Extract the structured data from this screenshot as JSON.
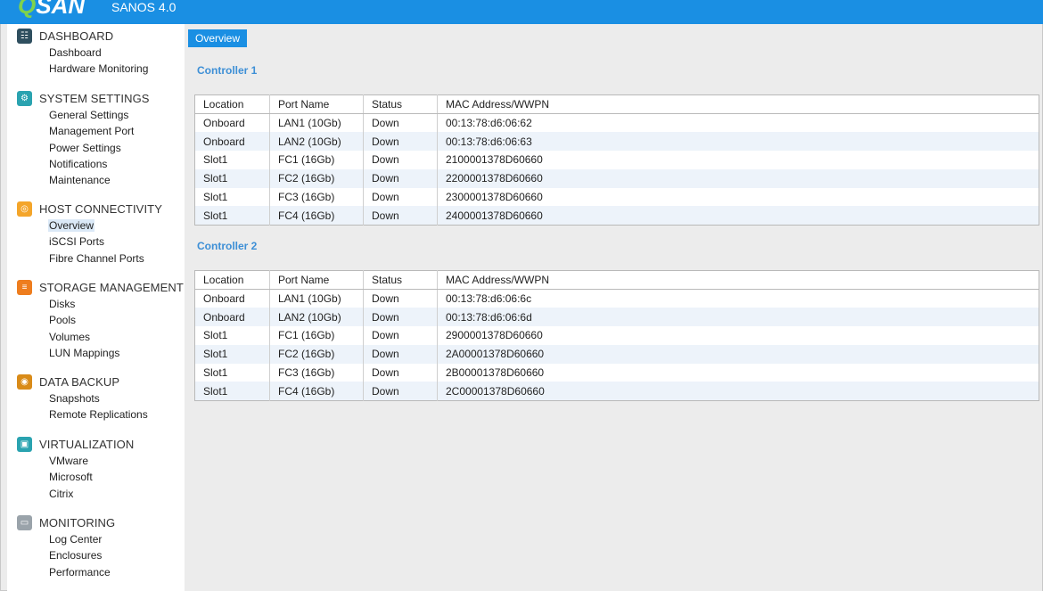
{
  "app": {
    "logo": "QSAN",
    "version": "SANOS 4.0"
  },
  "colors": {
    "brand": "#1a8fe3",
    "logo_accent": "#7fd34b",
    "section_title": "#3d8fd6"
  },
  "sidebar": [
    {
      "title": "DASHBOARD",
      "icon": "dashboard-icon",
      "items": [
        "Dashboard",
        "Hardware Monitoring"
      ]
    },
    {
      "title": "SYSTEM SETTINGS",
      "icon": "settings-icon",
      "items": [
        "General Settings",
        "Management Port",
        "Power Settings",
        "Notifications",
        "Maintenance"
      ]
    },
    {
      "title": "HOST CONNECTIVITY",
      "icon": "host-connectivity-icon",
      "items": [
        "Overview",
        "iSCSI Ports",
        "Fibre Channel Ports"
      ],
      "active": 0
    },
    {
      "title": "STORAGE MANAGEMENT",
      "icon": "storage-icon",
      "items": [
        "Disks",
        "Pools",
        "Volumes",
        "LUN Mappings"
      ]
    },
    {
      "title": "DATA BACKUP",
      "icon": "backup-icon",
      "items": [
        "Snapshots",
        "Remote Replications"
      ]
    },
    {
      "title": "VIRTUALIZATION",
      "icon": "virtualization-icon",
      "items": [
        "VMware",
        "Microsoft",
        "Citrix"
      ]
    },
    {
      "title": "MONITORING",
      "icon": "monitoring-icon",
      "items": [
        "Log Center",
        "Enclosures",
        "Performance"
      ]
    }
  ],
  "main": {
    "tab": "Overview",
    "columns": [
      "Location",
      "Port Name",
      "Status",
      "MAC Address/WWPN"
    ],
    "controllers": [
      {
        "title": "Controller 1",
        "rows": [
          [
            "Onboard",
            "LAN1 (10Gb)",
            "Down",
            "00:13:78:d6:06:62"
          ],
          [
            "Onboard",
            "LAN2 (10Gb)",
            "Down",
            "00:13:78:d6:06:63"
          ],
          [
            "Slot1",
            "FC1 (16Gb)",
            "Down",
            "2100001378D60660"
          ],
          [
            "Slot1",
            "FC2 (16Gb)",
            "Down",
            "2200001378D60660"
          ],
          [
            "Slot1",
            "FC3 (16Gb)",
            "Down",
            "2300001378D60660"
          ],
          [
            "Slot1",
            "FC4 (16Gb)",
            "Down",
            "2400001378D60660"
          ]
        ]
      },
      {
        "title": "Controller 2",
        "rows": [
          [
            "Onboard",
            "LAN1 (10Gb)",
            "Down",
            "00:13:78:d6:06:6c"
          ],
          [
            "Onboard",
            "LAN2 (10Gb)",
            "Down",
            "00:13:78:d6:06:6d"
          ],
          [
            "Slot1",
            "FC1 (16Gb)",
            "Down",
            "2900001378D60660"
          ],
          [
            "Slot1",
            "FC2 (16Gb)",
            "Down",
            "2A00001378D60660"
          ],
          [
            "Slot1",
            "FC3 (16Gb)",
            "Down",
            "2B00001378D60660"
          ],
          [
            "Slot1",
            "FC4 (16Gb)",
            "Down",
            "2C00001378D60660"
          ]
        ]
      }
    ]
  }
}
